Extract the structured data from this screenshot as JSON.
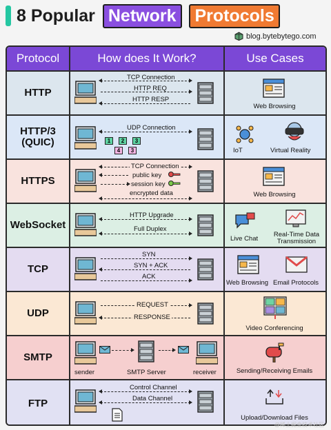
{
  "title": {
    "prefix": "8 Popular",
    "word1": "Network",
    "word2": "Protocols"
  },
  "brand": "blog.bytebytego.com",
  "header": {
    "protocol": "Protocol",
    "how": "How does It Work?",
    "use": "Use Cases"
  },
  "rows": [
    {
      "name": "HTTP",
      "color": "#dce6ee",
      "labels": [
        "TCP Connection",
        "HTTP REQ",
        "HTTP RESP"
      ],
      "uses": [
        "Web Browsing"
      ]
    },
    {
      "name": "HTTP/3\n(QUIC)",
      "color": "#dbe7f7",
      "labels": [
        "UDP Connection",
        "1",
        "2",
        "3",
        "4",
        "3"
      ],
      "uses": [
        "IoT",
        "Virtual Reality"
      ]
    },
    {
      "name": "HTTPS",
      "color": "#f9e3de",
      "labels": [
        "TCP Connection",
        "public key",
        "session key",
        "encrypted data"
      ],
      "uses": [
        "Web Browsing"
      ]
    },
    {
      "name": "WebSocket",
      "color": "#dcefe4",
      "labels": [
        "HTTP Upgrade",
        "Full Duplex"
      ],
      "uses": [
        "Live Chat",
        "Real-Time Data\nTransmission"
      ]
    },
    {
      "name": "TCP",
      "color": "#e4dcf1",
      "labels": [
        "SYN",
        "SYN + ACK",
        "ACK"
      ],
      "uses": [
        "Web Browsing",
        "Email Protocols"
      ]
    },
    {
      "name": "UDP",
      "color": "#fbe8d4",
      "labels": [
        "REQUEST",
        "RESPONSE"
      ],
      "uses": [
        "Video Conferencing"
      ]
    },
    {
      "name": "SMTP",
      "color": "#f6cfcf",
      "labels": [
        "sender",
        "SMTP Server",
        "receiver"
      ],
      "uses": [
        "Sending/Receiving Emails"
      ]
    },
    {
      "name": "FTP",
      "color": "#e1e1f3",
      "labels": [
        "Control Channel",
        "Data Channel"
      ],
      "uses": [
        "Upload/Download Files"
      ]
    }
  ],
  "watermark": "@稀土掘金技术社区",
  "colors": {
    "header": "#7b48d6",
    "accent_bar": "#25c7a2",
    "highlight1": "#8a4fe0",
    "highlight2": "#f07a32"
  }
}
